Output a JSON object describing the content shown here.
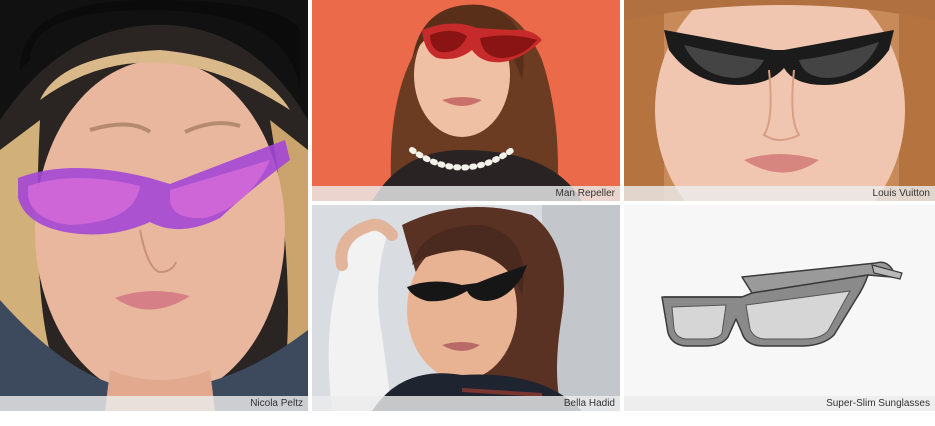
{
  "tiles": [
    {
      "caption": "Nicola Peltz",
      "lens_color": "#d36ad8",
      "frame_color": "#a447d6"
    },
    {
      "caption": "Man Repeller",
      "lens_color": "#c62a2a",
      "backdrop_color": "#ea6a4a"
    },
    {
      "caption": "Louis Vuitton",
      "lens_color": "#1b1b1b"
    },
    {
      "caption": "Bella Hadid",
      "lens_color": "#161616"
    },
    {
      "caption": "Super-Slim Sunglasses",
      "lens_color": "#d6d6d6",
      "frame_color": "#8a8a8a"
    }
  ]
}
